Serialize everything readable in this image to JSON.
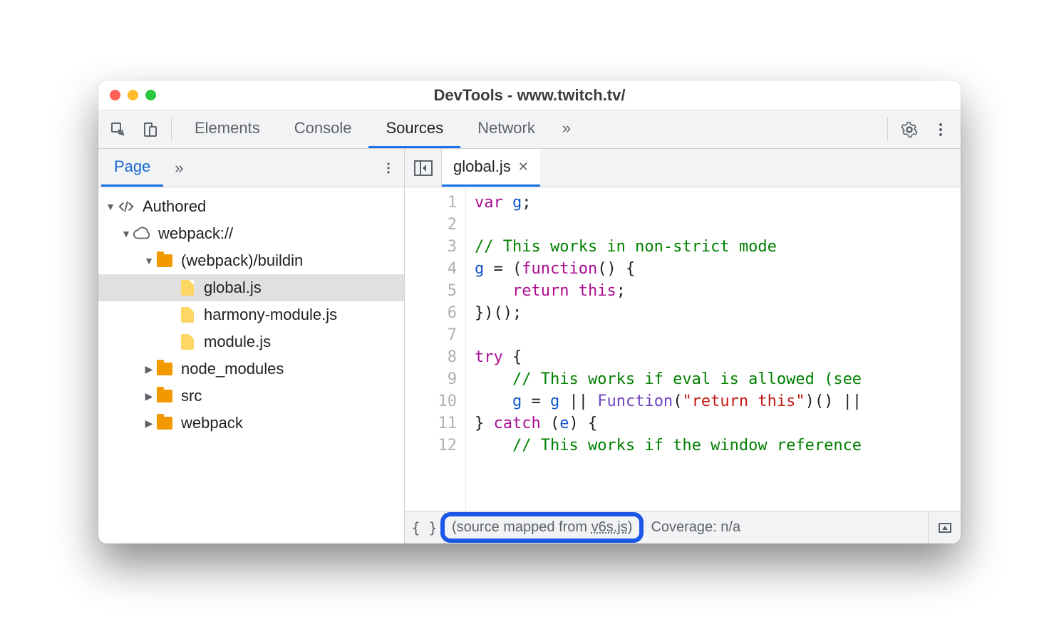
{
  "window": {
    "title": "DevTools - www.twitch.tv/"
  },
  "main_tabs": {
    "items": [
      "Elements",
      "Console",
      "Sources",
      "Network"
    ],
    "more": "»",
    "active_index": 2
  },
  "sidebar": {
    "tab": "Page",
    "more": "»",
    "tree": {
      "root": "Authored",
      "domain": "webpack://",
      "folder_open": "(webpack)/buildin",
      "files": [
        "global.js",
        "harmony-module.js",
        "module.js"
      ],
      "selected_index": 0,
      "folders_closed": [
        "node_modules",
        "src",
        "webpack"
      ]
    }
  },
  "editor": {
    "open_tab": "global.js",
    "code": {
      "lines": [
        {
          "n": 1,
          "html": "<span class='kw'>var</span> <span class='var'>g</span>;"
        },
        {
          "n": 2,
          "html": ""
        },
        {
          "n": 3,
          "html": "<span class='cm'>// This works in non-strict mode</span>"
        },
        {
          "n": 4,
          "html": "<span class='var'>g</span> = (<span class='kw'>function</span>() {"
        },
        {
          "n": 5,
          "html": "    <span class='kw'>return</span> <span class='kw'>this</span>;"
        },
        {
          "n": 6,
          "html": "})();"
        },
        {
          "n": 7,
          "html": ""
        },
        {
          "n": 8,
          "html": "<span class='kw'>try</span> {"
        },
        {
          "n": 9,
          "html": "    <span class='cm'>// This works if eval is allowed (see</span>"
        },
        {
          "n": 10,
          "html": "    <span class='var'>g</span> = <span class='var'>g</span> || <span class='fn'>Function</span>(<span class='str'>\"return this\"</span>)() ||"
        },
        {
          "n": 11,
          "html": "} <span class='kw'>catch</span> (<span class='var'>e</span>) {"
        },
        {
          "n": 12,
          "html": "    <span class='cm'>// This works if the window reference</span>"
        }
      ]
    }
  },
  "status": {
    "map_prefix": "(source mapped from ",
    "map_link": "v6s.js",
    "map_suffix": ")",
    "coverage": "Coverage: n/a"
  }
}
